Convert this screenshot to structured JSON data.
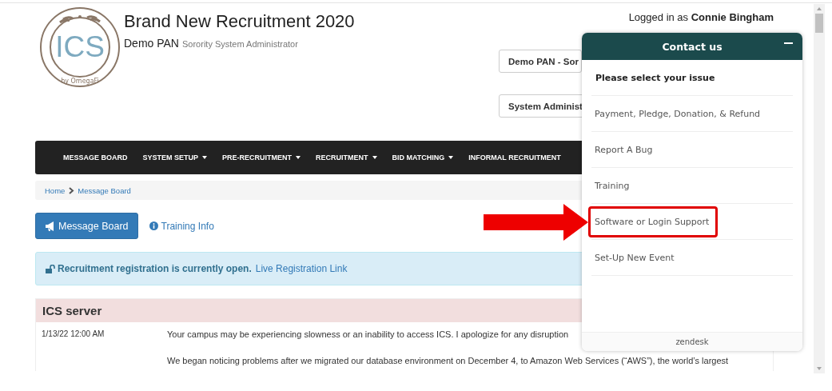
{
  "header": {
    "logo": {
      "text": "ICS",
      "byline": "by OmegaFi"
    },
    "title": "Brand New Recruitment 2020",
    "organization": "Demo PAN",
    "role": "Sorority System Administrator",
    "user": "Logged in as **Connie Bingham**",
    "selects": [
      "Demo PAN - Sor",
      "System Administ"
    ]
  },
  "navbar": [
    {
      "label": "MESSAGE BOARD",
      "dropdown": false
    },
    {
      "label": "SYSTEM SETUP",
      "dropdown": true
    },
    {
      "label": "PRE-RECRUITMENT",
      "dropdown": true
    },
    {
      "label": "RECRUITMENT",
      "dropdown": true
    },
    {
      "label": "BID MATCHING",
      "dropdown": true
    },
    {
      "label": "INFORMAL RECRUITMENT",
      "dropdown": false
    }
  ],
  "breadcrumb": [
    "Home",
    "Message Board"
  ],
  "actions": [
    {
      "kind": "button",
      "label": "Message Board"
    },
    {
      "kind": "link",
      "label": "Training Info"
    }
  ],
  "alert": {
    "text": "Recruitment registration is currently open.",
    "link": "Live Registration Link"
  },
  "post": {
    "title": "ICS server",
    "date": "1/13/22 12:00 AM",
    "paragraphs": [
      "Your campus may be experiencing slowness or an inability to access ICS. I apologize for any disruption",
      "We began noticing problems after we migrated our database environment on December 4, to Amazon Web Services (“AWS”), the world’s largest"
    ]
  },
  "widget": {
    "title": "Contact us",
    "heading": "Please select your issue",
    "options": [
      {
        "label": "Payment, Pledge, Donation, & Refund",
        "highlighted": false
      },
      {
        "label": "Report A Bug",
        "highlighted": false
      },
      {
        "label": "Training",
        "highlighted": false
      },
      {
        "label": "Software or Login Support",
        "highlighted": true
      },
      {
        "label": "Set-Up New Event",
        "highlighted": false
      }
    ],
    "footer": "zendesk"
  }
}
